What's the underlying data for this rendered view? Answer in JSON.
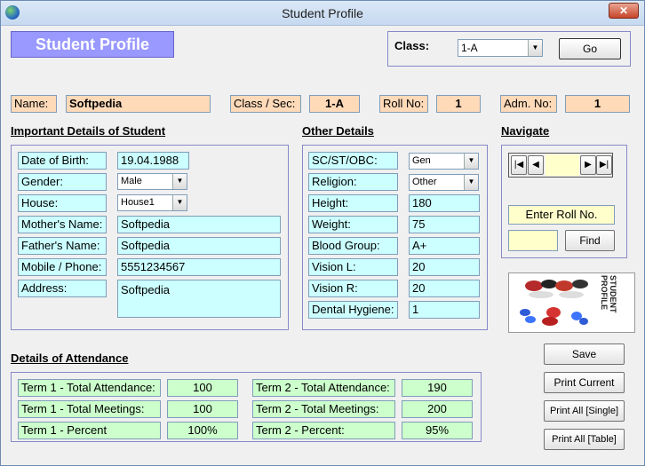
{
  "window": {
    "title": "Student Profile",
    "close_label": "✕"
  },
  "banner": "Student Profile",
  "class_select": {
    "label": "Class:",
    "value": "1-A",
    "go_label": "Go"
  },
  "summary": {
    "name_label": "Name:",
    "name_value": "Softpedia",
    "class_sec_label": "Class / Sec:",
    "class_sec_value": "1-A",
    "roll_label": "Roll No:",
    "roll_value": "1",
    "adm_label": "Adm. No:",
    "adm_value": "1"
  },
  "important": {
    "heading": "Important Details of Student",
    "dob_label": "Date of Birth:",
    "dob_value": "19.04.1988",
    "gender_label": "Gender:",
    "gender_value": "Male",
    "house_label": "House:",
    "house_value": "House1",
    "mother_label": "Mother's Name:",
    "mother_value": "Softpedia",
    "father_label": "Father's Name:",
    "father_value": "Softpedia",
    "mobile_label": "Mobile / Phone:",
    "mobile_value": "5551234567",
    "address_label": "Address:",
    "address_value": "Softpedia"
  },
  "other": {
    "heading": "Other Details",
    "caste_label": "SC/ST/OBC:",
    "caste_value": "Gen",
    "religion_label": "Religion:",
    "religion_value": "Other",
    "height_label": "Height:",
    "height_value": "180",
    "weight_label": "Weight:",
    "weight_value": "75",
    "blood_label": "Blood Group:",
    "blood_value": "A+",
    "visionl_label": "Vision L:",
    "visionl_value": "20",
    "visionr_label": "Vision R:",
    "visionr_value": "20",
    "dental_label": "Dental Hygiene:",
    "dental_value": "1"
  },
  "navigate": {
    "heading": "Navigate",
    "first": "|◀",
    "prev": "◀",
    "next": "▶",
    "last": "▶|",
    "enter_roll_label": "Enter Roll No.",
    "find_label": "Find"
  },
  "logo_text": "STUDENT PROFILE",
  "attendance": {
    "heading": "Details of Attendance",
    "t1_att_label": "Term 1 - Total Attendance:",
    "t1_att_value": "100",
    "t1_meet_label": "Term 1 - Total Meetings:",
    "t1_meet_value": "100",
    "t1_pct_label": "Term 1 - Percent",
    "t1_pct_value": "100%",
    "t2_att_label": "Term 2 - Total Attendance:",
    "t2_att_value": "190",
    "t2_meet_label": "Term 2 - Total Meetings:",
    "t2_meet_value": "200",
    "t2_pct_label": "Term 2 - Percent:",
    "t2_pct_value": "95%"
  },
  "actions": {
    "save": "Save",
    "print_current": "Print Current",
    "print_single": "Print All [Single]",
    "print_table": "Print All [Table]"
  }
}
